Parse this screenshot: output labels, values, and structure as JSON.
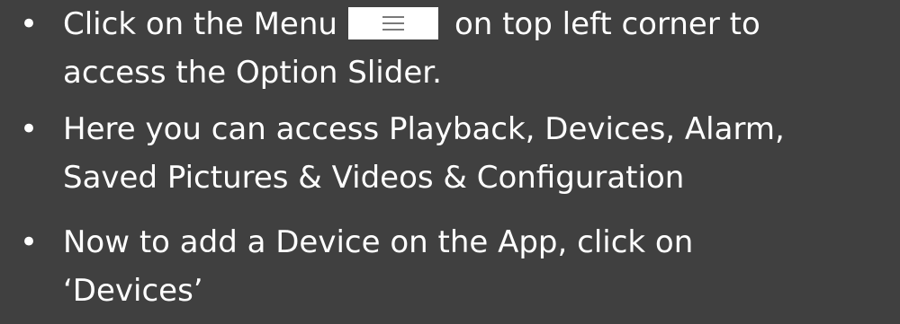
{
  "slide": {
    "bullet_glyph": "•",
    "bullets": [
      {
        "line1_before": "Click on the Menu",
        "menu_icon": "hamburger-menu-icon",
        "line1_after": "on top left corner to",
        "line2": "access the Option Slider."
      },
      {
        "line1": "Here you can access Playback, Devices, Alarm,",
        "line2": "Saved Pictures & Videos & Configuration"
      },
      {
        "line1": "Now to add a Device on the App, click on",
        "line2": "‘Devices’"
      }
    ]
  },
  "colors": {
    "background": "#404040",
    "text": "#ffffff",
    "menu_button_bg": "#ffffff",
    "menu_icon": "#7a7a7a"
  }
}
